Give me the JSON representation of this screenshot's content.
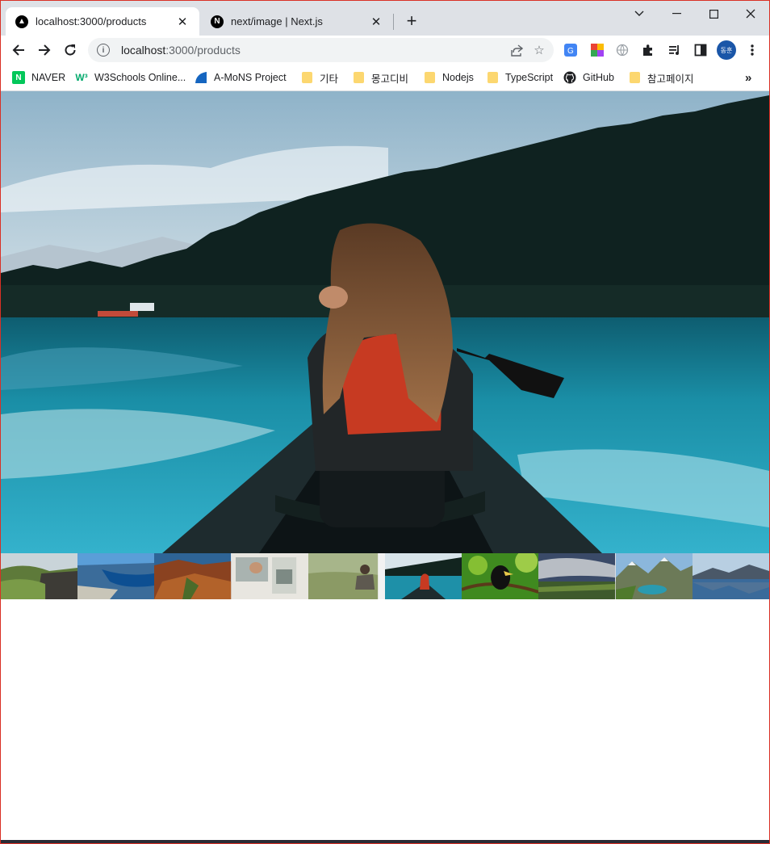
{
  "browser": {
    "tabs": [
      {
        "title": "localhost:3000/products",
        "favicon": "nextjs-triangle-icon",
        "active": true
      },
      {
        "title": "next/image | Next.js",
        "favicon": "nextjs-n-icon",
        "active": false
      }
    ],
    "url_host": "localhost",
    "url_path": ":3000/products",
    "avatar_label": "동훈"
  },
  "bookmarks": [
    {
      "label": "NAVER",
      "icon": "naver-icon"
    },
    {
      "label": "W3Schools Online...",
      "icon": "w3schools-icon"
    },
    {
      "label": "A-MoNS Project",
      "icon": "amons-icon"
    },
    {
      "label": "기타",
      "icon": "folder-icon"
    },
    {
      "label": "몽고디비",
      "icon": "folder-icon"
    },
    {
      "label": "Nodejs",
      "icon": "folder-icon"
    },
    {
      "label": "TypeScript",
      "icon": "folder-icon"
    },
    {
      "label": "GitHub",
      "icon": "github-icon"
    },
    {
      "label": "참고페이지",
      "icon": "folder-icon"
    }
  ],
  "gallery": {
    "main_image": "woman-in-canoe-on-turquoise-lake",
    "selected_index": 5,
    "thumbnails": [
      "green-cliffs-coast",
      "blue-fjord",
      "red-rock-mountains",
      "person-by-van-window",
      "person-in-grass-field",
      "woman-in-canoe-on-lake",
      "hornbill-bird-on-branch",
      "cloudy-sky-over-fields",
      "mountain-valley-lake",
      "mountain-lake-reflection"
    ]
  }
}
